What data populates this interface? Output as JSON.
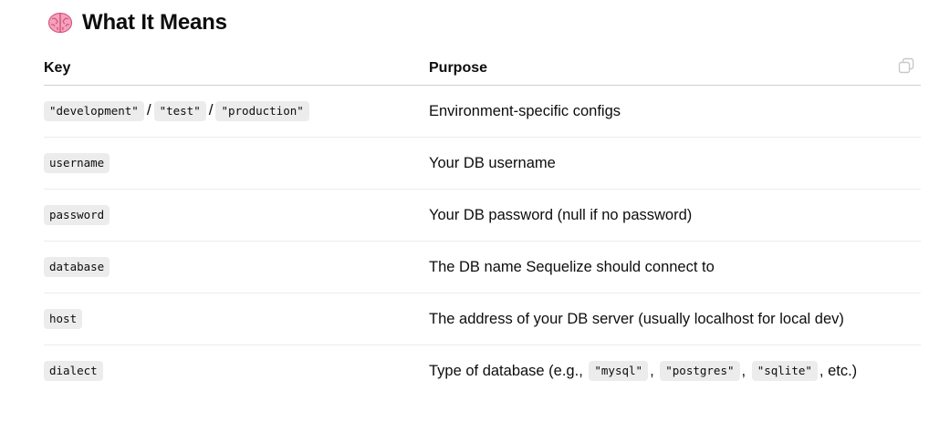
{
  "section": {
    "title": "What It Means",
    "icon": "brain-emoji"
  },
  "table": {
    "headers": {
      "key": "Key",
      "purpose": "Purpose"
    },
    "rows": [
      {
        "keys": [
          "\"development\"",
          "\"test\"",
          "\"production\""
        ],
        "separator": "/",
        "purpose": "Environment-specific configs"
      },
      {
        "key": "username",
        "purpose": "Your DB username"
      },
      {
        "key": "password",
        "purpose": "Your DB password (null if no password)"
      },
      {
        "key": "database",
        "purpose": "The DB name Sequelize should connect to"
      },
      {
        "key": "host",
        "purpose": "The address of your DB server (usually localhost for local dev)"
      },
      {
        "key": "dialect",
        "purpose_prefix": "Type of database (e.g.,",
        "purpose_codes": [
          "\"mysql\"",
          "\"postgres\"",
          "\"sqlite\""
        ],
        "purpose_comma": ",",
        "purpose_suffix": ", etc.)"
      }
    ]
  },
  "toolbar": {
    "copy_icon": "copy-icon"
  },
  "colors": {
    "code_bg": "#ececec",
    "header_border": "#cfcfcf",
    "row_border": "#ececec",
    "brain_pink": "#f08fb0"
  }
}
